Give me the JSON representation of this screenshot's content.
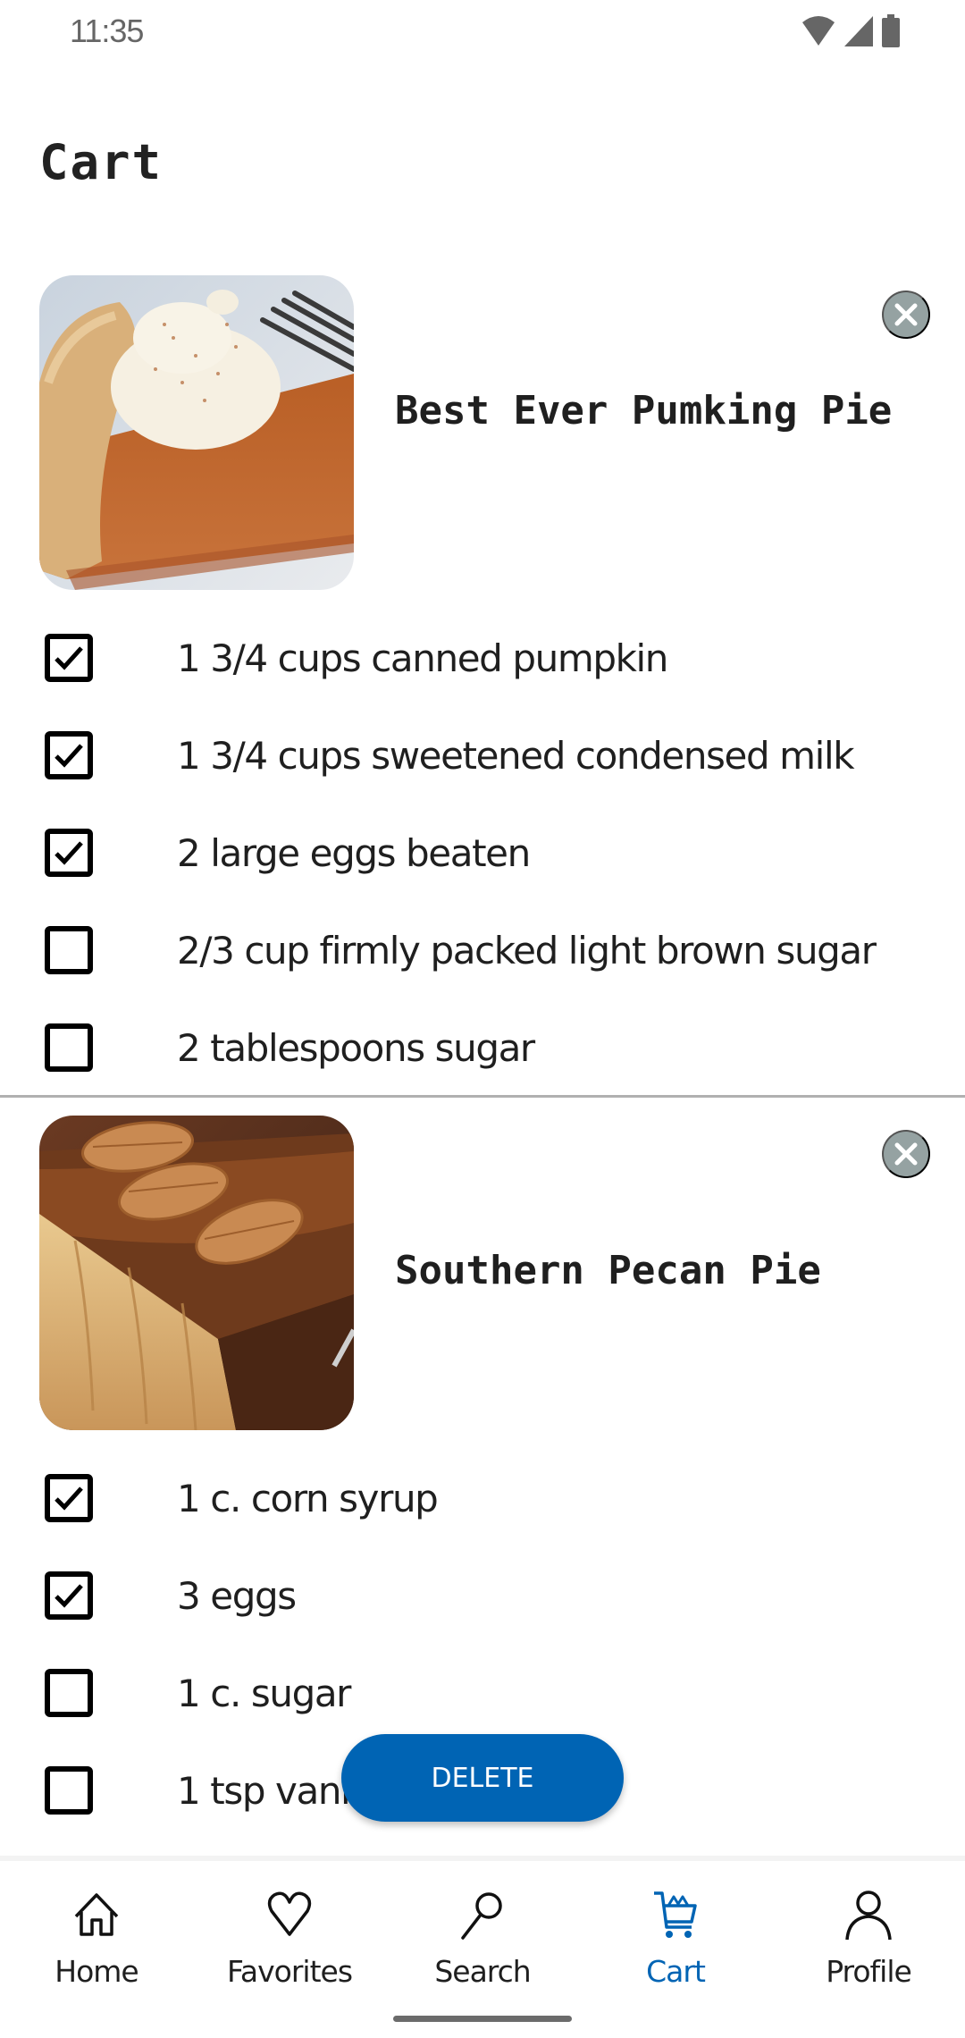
{
  "status_bar": {
    "time": "11:35",
    "icons": [
      "wifi-icon",
      "cell-signal-icon",
      "battery-icon"
    ]
  },
  "page": {
    "title": "Cart"
  },
  "recipes": [
    {
      "title": "Best Ever Pumking Pie",
      "image": "pumpkin-pie-photo",
      "remove_icon": "close-circle-icon",
      "ingredients": [
        {
          "label": "1 3/4 cups canned pumpkin",
          "checked": true
        },
        {
          "label": "1 3/4 cups sweetened condensed milk",
          "checked": true
        },
        {
          "label": "2 large eggs beaten",
          "checked": true
        },
        {
          "label": "2/3 cup firmly packed light brown sugar",
          "checked": false
        },
        {
          "label": "2 tablespoons sugar",
          "checked": false
        }
      ]
    },
    {
      "title": "Southern Pecan Pie",
      "image": "pecan-pie-photo",
      "remove_icon": "close-circle-icon",
      "ingredients": [
        {
          "label": "1 c. corn syrup",
          "checked": true
        },
        {
          "label": "3 eggs",
          "checked": true
        },
        {
          "label": "1 c. sugar",
          "checked": false
        },
        {
          "label": "1 tsp vanilla",
          "checked": false
        }
      ]
    }
  ],
  "actions": {
    "delete_label": "DELETE"
  },
  "bottom_nav": {
    "items": [
      {
        "label": "Home",
        "icon": "home-icon",
        "active": false
      },
      {
        "label": "Favorites",
        "icon": "heart-icon",
        "active": false
      },
      {
        "label": "Search",
        "icon": "search-icon",
        "active": false
      },
      {
        "label": "Cart",
        "icon": "cart-icon",
        "active": true
      },
      {
        "label": "Profile",
        "icon": "profile-icon",
        "active": false
      }
    ]
  },
  "colors": {
    "accent": "#0064b4",
    "remove_button": "#95a2a2",
    "text": "#1f1f1f",
    "divider": "#b0b0b0"
  }
}
